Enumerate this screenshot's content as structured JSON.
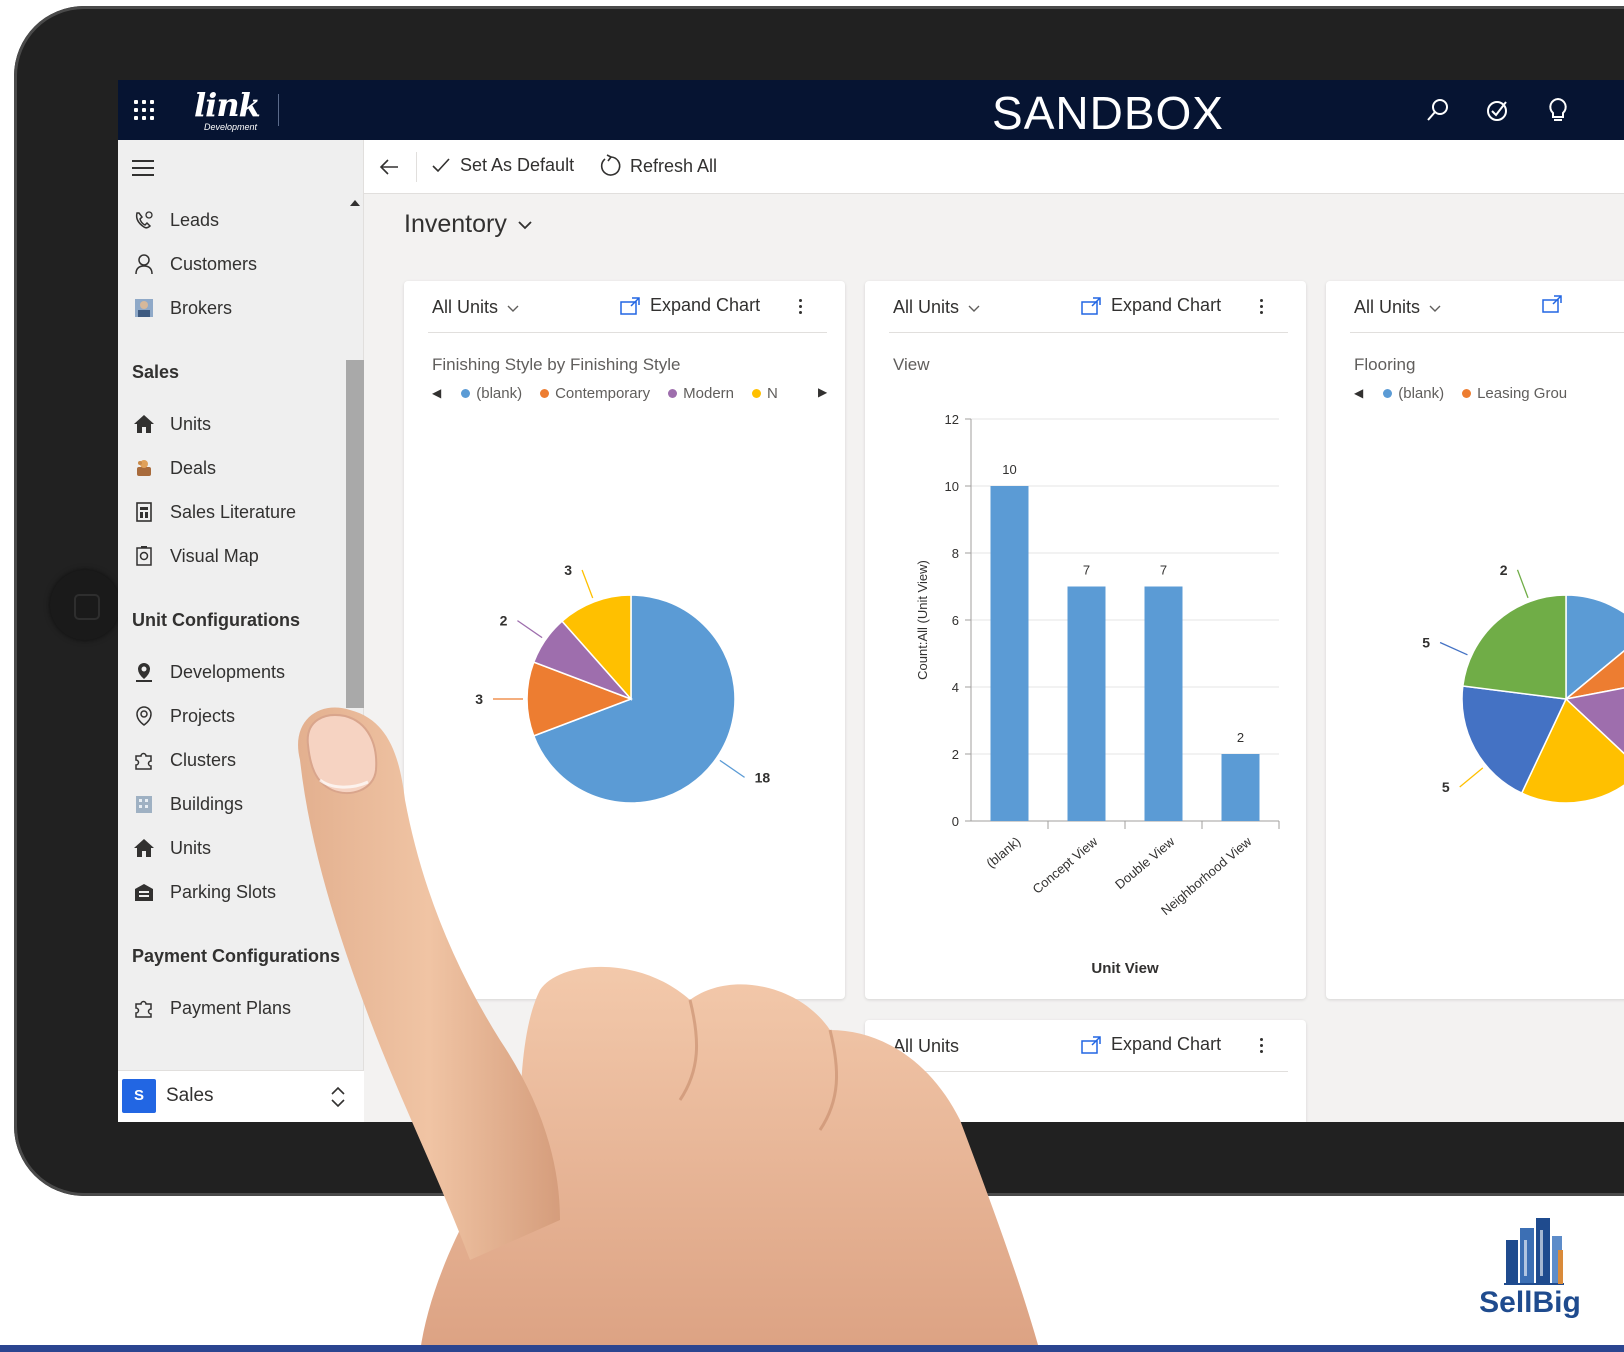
{
  "topbar": {
    "env_title": "SANDBOX",
    "brand_word": "link",
    "brand_sub": "Development"
  },
  "sidebar": {
    "top_items": [
      {
        "label": "Leads",
        "icon": "phone-icon"
      },
      {
        "label": "Customers",
        "icon": "person-icon"
      },
      {
        "label": "Brokers",
        "icon": "broker-icon"
      }
    ],
    "groups": [
      {
        "title": "Sales",
        "items": [
          {
            "label": "Units",
            "icon": "home-icon"
          },
          {
            "label": "Deals",
            "icon": "deal-icon"
          },
          {
            "label": "Sales Literature",
            "icon": "document-icon"
          },
          {
            "label": "Visual Map",
            "icon": "map-icon"
          }
        ]
      },
      {
        "title": "Unit Configurations",
        "items": [
          {
            "label": "Developments",
            "icon": "location-pin-icon"
          },
          {
            "label": "Projects",
            "icon": "pin-icon"
          },
          {
            "label": "Clusters",
            "icon": "puzzle-icon"
          },
          {
            "label": "Buildings",
            "icon": "building-icon"
          },
          {
            "label": "Units",
            "icon": "home-icon"
          },
          {
            "label": "Parking Slots",
            "icon": "garage-icon"
          }
        ]
      },
      {
        "title": "Payment Configurations",
        "items": [
          {
            "label": "Payment Plans",
            "icon": "puzzle-icon"
          }
        ]
      }
    ],
    "area": {
      "badge": "S",
      "label": "Sales"
    }
  },
  "cmdbar": {
    "set_default": "Set As Default",
    "refresh_all": "Refresh All"
  },
  "page": {
    "title": "Inventory"
  },
  "cards": [
    {
      "view": "All Units",
      "expand": "Expand Chart",
      "title": "Finishing Style by Finishing Style",
      "legend": [
        "(blank)",
        "Contemporary",
        "Modern",
        "N"
      ]
    },
    {
      "view": "All Units",
      "expand": "Expand Chart",
      "title": "View",
      "legend": []
    },
    {
      "view": "All Units",
      "expand": "",
      "title": "Flooring",
      "legend": [
        "(blank)",
        "Leasing Grou"
      ]
    },
    {
      "view": "All Units",
      "expand": "Expand Chart",
      "title": "",
      "legend": []
    }
  ],
  "chart_data": [
    {
      "type": "pie",
      "title": "Finishing Style by Finishing Style",
      "categories": [
        "(blank)",
        "Contemporary",
        "Modern",
        "N"
      ],
      "values": [
        18,
        3,
        2,
        3
      ],
      "colors": [
        "#5b9bd5",
        "#ed7d31",
        "#9e6ead",
        "#ffc000"
      ],
      "legend": "top"
    },
    {
      "type": "bar",
      "title": "View",
      "categories": [
        "(blank)",
        "Concept View",
        "Double View",
        "Neighborhood View"
      ],
      "values": [
        10,
        7,
        7,
        2
      ],
      "xlabel": "Unit View",
      "ylabel": "Count:All (Unit View)",
      "ylim": [
        0,
        12
      ],
      "yticks": [
        0,
        2,
        4,
        6,
        8,
        10,
        12
      ],
      "grid": true,
      "color": "#5b9bd5"
    },
    {
      "type": "pie",
      "title": "Flooring",
      "categories": [
        "(blank)",
        "Leasing Grou"
      ],
      "labels_visible": [
        2,
        5,
        5
      ],
      "colors": [
        "#5b9bd5",
        "#ed7d31",
        "#70ad47",
        "#4472c4",
        "#ffc000",
        "#9e6ead"
      ],
      "legend": "top"
    }
  ],
  "branding": {
    "logo_text": "SellBig"
  },
  "colors": {
    "topbar": "#061432",
    "accent": "#2266e3",
    "bar": "#5b9bd5",
    "footer_line": "#2b4590"
  }
}
